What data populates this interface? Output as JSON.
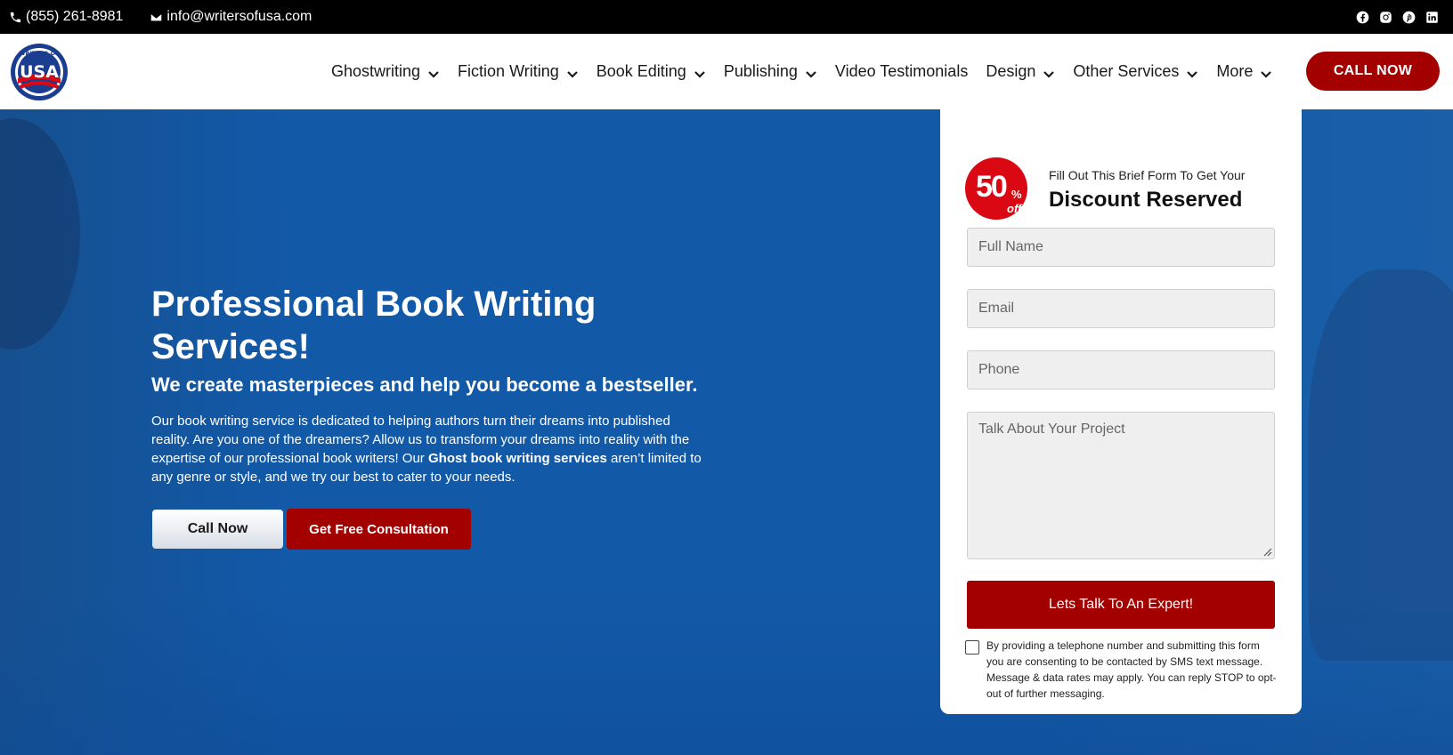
{
  "topbar": {
    "phone": "(855) 261-8981",
    "email": "info@writersofusa.com",
    "socials": [
      "facebook-icon",
      "instagram-icon",
      "pinterest-icon",
      "linkedin-icon"
    ]
  },
  "nav": {
    "logo_text": "USA",
    "logo_ring_text": "WRITERS OF",
    "items": [
      {
        "label": "Ghostwriting",
        "dropdown": true
      },
      {
        "label": "Fiction Writing",
        "dropdown": true
      },
      {
        "label": "Book Editing",
        "dropdown": true
      },
      {
        "label": "Publishing",
        "dropdown": true
      },
      {
        "label": "Video Testimonials",
        "dropdown": false
      },
      {
        "label": "Design",
        "dropdown": true
      },
      {
        "label": "Other Services",
        "dropdown": true
      },
      {
        "label": "More",
        "dropdown": true
      }
    ],
    "call_now": "CALL NOW"
  },
  "hero": {
    "headline_light": "Professional ",
    "headline_bold": "Book Writing Services!",
    "subhead": "We create masterpieces and help you become a bestseller.",
    "para_start": "Our book writing service is dedicated to helping authors turn their dreams into published reality. Are you one of the dreamers? Allow us to transform your dreams into reality with the expertise of our professional book writers! Our ",
    "para_bold": "Ghost book writing services",
    "para_end": " aren’t limited to any genre or style, and we try our best to cater to your needs.",
    "btn_call": "Call Now",
    "btn_consult": "Get Free Consultation"
  },
  "form": {
    "badge_num": "50",
    "badge_pct": "%",
    "badge_off": "off",
    "lead": "Fill Out This Brief Form To Get Your",
    "title": "Discount Reserved",
    "name_placeholder": "Full Name",
    "email_placeholder": "Email",
    "phone_placeholder": "Phone",
    "project_placeholder": "Talk About Your Project",
    "submit": "Lets Talk To An Expert!",
    "consent": "By providing a telephone number and submitting this form you are consenting to be contacted by SMS text message. Message & data rates may apply. You can reply STOP to opt-out of further messaging."
  },
  "colors": {
    "accent_red": "#a30000",
    "hero_blue": "#1259a8",
    "badge_red": "#d90812"
  }
}
